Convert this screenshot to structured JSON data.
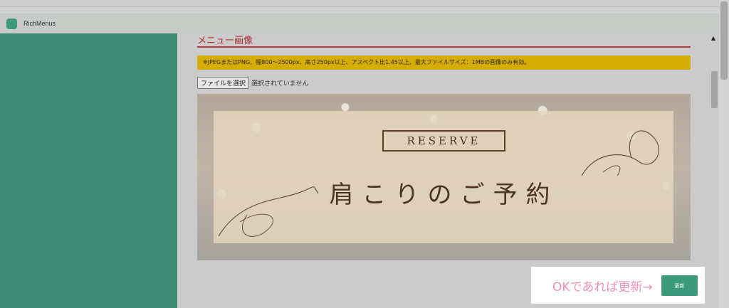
{
  "app": {
    "title": "RichMenus",
    "logo_color": "#3f9a7c"
  },
  "section": {
    "title": "メニュー画像"
  },
  "notice": {
    "text": "※JPEGまたはPNG、幅800～2500px、高さ250px以上、アスペクト比1.45以上、最大ファイルサイズ：1MBの画像のみ有効。"
  },
  "file_input": {
    "button_label": "ファイルを選択",
    "status": "選択されていません"
  },
  "menu_image": {
    "badge": "RESERVE",
    "headline": "肩こりのご予約"
  },
  "callout": {
    "text": "OKであれば更新→",
    "button_label": "更新"
  },
  "colors": {
    "sidebar": "#3e8a72",
    "accent_red": "#a8302e",
    "notice_bg": "#d6ad05",
    "button_green": "#3e9a7c",
    "callout_text": "#f090b8"
  },
  "icons": {
    "scroll_up": "chevron-up-icon"
  }
}
